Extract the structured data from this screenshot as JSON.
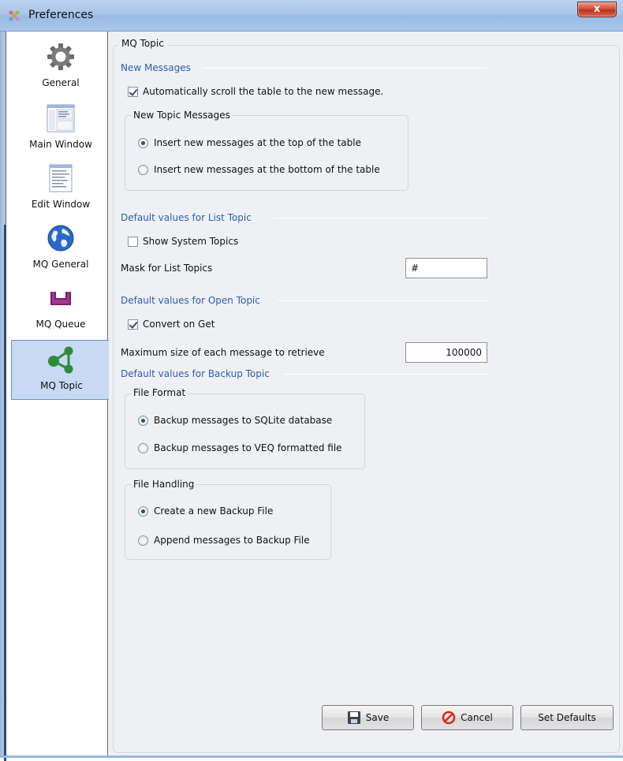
{
  "window": {
    "title": "Preferences",
    "close_label": "x"
  },
  "sidebar": {
    "items": [
      {
        "label": "General",
        "icon": "gear-icon"
      },
      {
        "label": "Main Window",
        "icon": "main-window-icon"
      },
      {
        "label": "Edit Window",
        "icon": "edit-window-icon"
      },
      {
        "label": "MQ General",
        "icon": "globe-icon"
      },
      {
        "label": "MQ Queue",
        "icon": "queue-icon"
      },
      {
        "label": "MQ Topic",
        "icon": "topic-icon",
        "selected": true
      }
    ]
  },
  "panel": {
    "title": "MQ Topic",
    "new_messages": {
      "heading": "New Messages",
      "auto_scroll_label": "Automatically scroll the table to the new message.",
      "auto_scroll_checked": true,
      "topic_group": {
        "title": "New Topic Messages",
        "options": [
          {
            "label": "Insert new messages at the top of the table",
            "selected": true
          },
          {
            "label": "Insert new messages at the bottom of the table",
            "selected": false
          }
        ]
      }
    },
    "list_topic": {
      "heading": "Default values for List Topic",
      "show_system_label": "Show System Topics",
      "show_system_checked": false,
      "mask_label": "Mask for List Topics",
      "mask_value": "#"
    },
    "open_topic": {
      "heading": "Default values for Open Topic",
      "convert_label": "Convert on Get",
      "convert_checked": true,
      "max_size_label": "Maximum size of each message to retrieve",
      "max_size_value": "100000"
    },
    "backup_topic": {
      "heading": "Default values for Backup Topic",
      "file_format": {
        "title": "File Format",
        "options": [
          {
            "label": "Backup messages to SQLite database",
            "selected": true
          },
          {
            "label": "Backup messages to VEQ formatted file",
            "selected": false
          }
        ]
      },
      "file_handling": {
        "title": "File Handling",
        "options": [
          {
            "label": "Create a new Backup File",
            "selected": true
          },
          {
            "label": "Append messages to Backup File",
            "selected": false
          }
        ]
      }
    }
  },
  "buttons": {
    "save": "Save",
    "cancel": "Cancel",
    "set_defaults": "Set Defaults"
  },
  "colors": {
    "heading": "#2f5fae",
    "selected_nav": "#c7d9f3",
    "background": "#eef0f3"
  }
}
